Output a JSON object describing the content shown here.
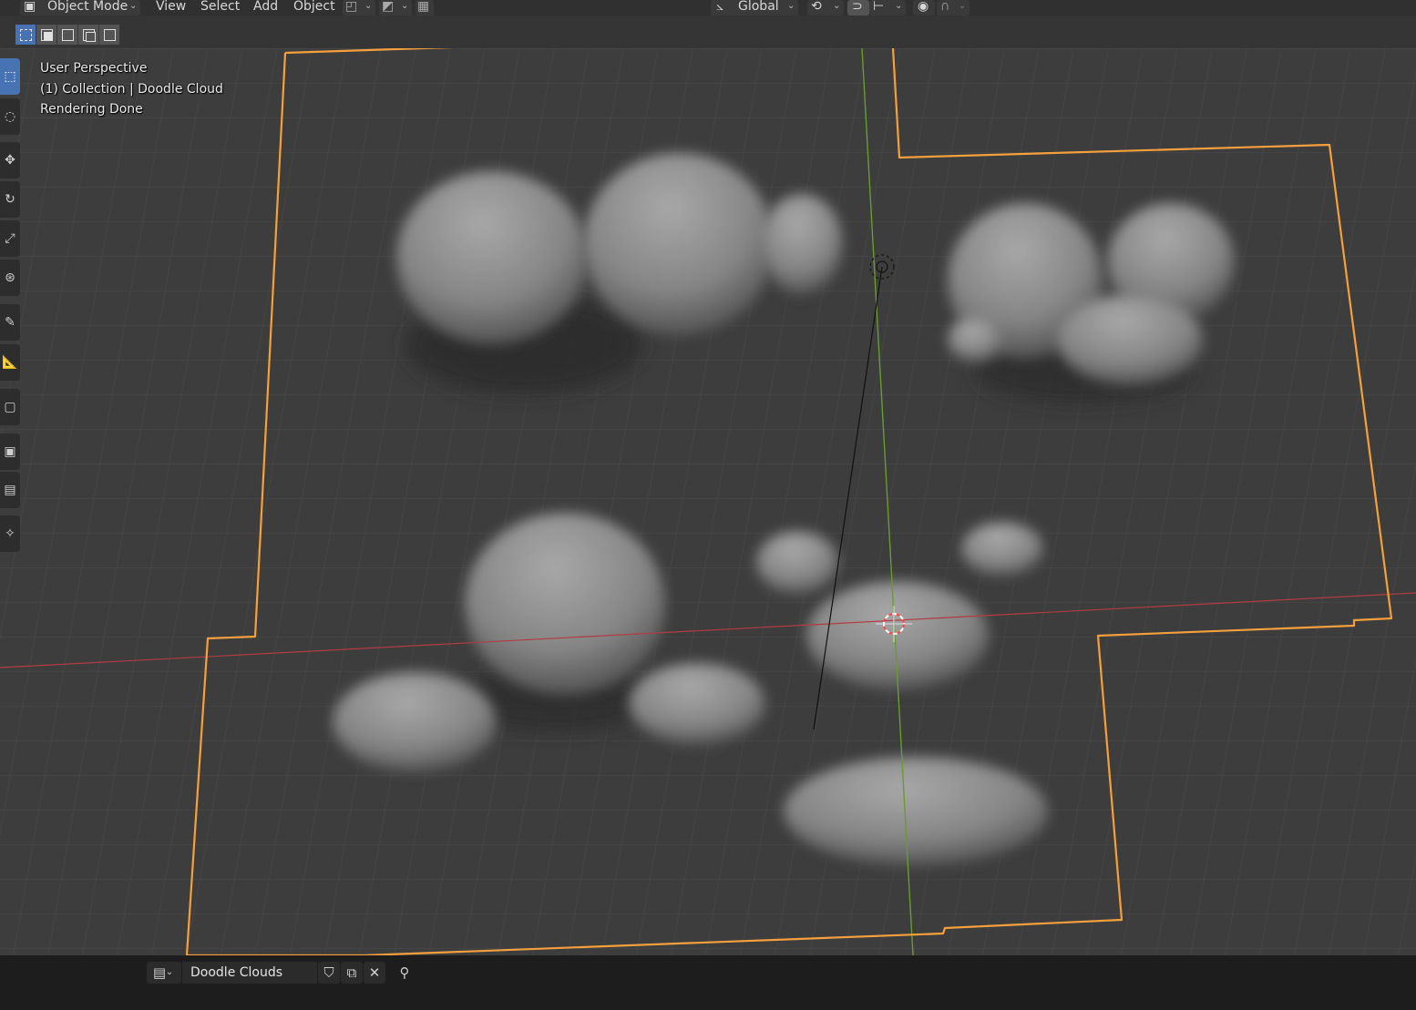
{
  "header": {
    "mode": "Object Mode",
    "menus": [
      "View",
      "Select",
      "Add",
      "Object"
    ],
    "transform_orientation": "Global"
  },
  "viewport": {
    "info_lines": [
      "User Perspective",
      "(1) Collection | Doodle Cloud",
      "Rendering Done"
    ]
  },
  "tools": [
    "select-box-tool",
    "cursor-tool",
    "move-tool",
    "rotate-tool",
    "scale-tool",
    "transform-tool",
    "annotate-tool",
    "measure-tool",
    "add-cube-tool",
    "tool-extra-1",
    "tool-extra-2",
    "tool-extra-3"
  ],
  "footer": {
    "datablock_name": "Doodle Clouds"
  },
  "colors": {
    "selection_outline": "#f5a03c",
    "x_axis": "#b13c44",
    "y_axis": "#6a9b2e",
    "active_tool": "#4772b3"
  }
}
